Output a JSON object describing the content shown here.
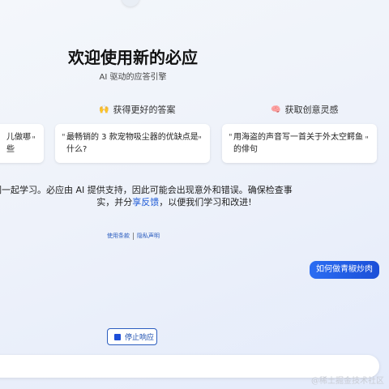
{
  "header": {
    "title": "欢迎使用新的必应",
    "subtitle": "AI 驱动的应答引擎"
  },
  "features": [
    {
      "icon": "partial-icon",
      "heading": ""
    },
    {
      "icon": "hands-raised-icon",
      "heading": "获得更好的答案"
    },
    {
      "icon": "brain-icon",
      "heading": "获取创意灵感"
    }
  ],
  "examples": [
    {
      "text": "儿做哪些"
    },
    {
      "text": "最畅销的 3 款宠物吸尘器的优缺点是什么?"
    },
    {
      "text": "用海盗的声音写一首关于外太空鳄鱼的俳句"
    }
  ],
  "disclaimer": {
    "line1": "我们一起学习。必应由 AI 提供支持，因此可能会出现意外和错误。确保检查事",
    "line2_pre": "实，并分",
    "line2_link": "享反馈",
    "line2_post": "，以便我们学习和改进!"
  },
  "footer": {
    "terms": "使用条款",
    "privacy": "隐私声明"
  },
  "chat": {
    "user_message": "如何做青椒炒肉"
  },
  "controls": {
    "stop_label": "停止响应"
  },
  "watermark": "@稀土掘金技术社区",
  "colors": {
    "accent": "#1d5ad6",
    "user_bubble": "#2563eb"
  }
}
